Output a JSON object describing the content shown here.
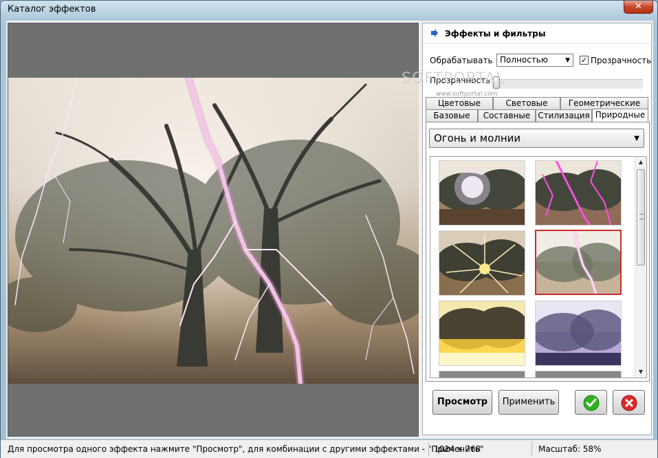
{
  "window": {
    "title": "Каталог эффектов",
    "close_glyph": "✕"
  },
  "panel": {
    "header_title": "Эффекты и фильтры",
    "header_icon": "blue-arrow-right-icon",
    "process_label": "Обрабатывать",
    "process_value": "Полностью",
    "transparency_checkbox_label": "Прозрачность",
    "transparency_checked": true,
    "transparency_slider_label": "Прозрачность",
    "transparency_level": 0,
    "watermark": "SOFTPORTAL",
    "watermark_sub": "www.softportal.com"
  },
  "tabs": {
    "row_top": [
      "Цветовые",
      "Световые",
      "Геометрические"
    ],
    "row_bottom": [
      "Базовые",
      "Составные",
      "Стилизация",
      "Природные"
    ],
    "active": "Природные"
  },
  "category": {
    "selected": "Огонь и молнии"
  },
  "effects": [
    {
      "name": "sun-flare"
    },
    {
      "name": "purple-lightning"
    },
    {
      "name": "sunburst-rays"
    },
    {
      "name": "white-lightning",
      "selected": true
    },
    {
      "name": "fire-glow"
    },
    {
      "name": "violet-haze"
    }
  ],
  "buttons": {
    "preview": "Просмотр",
    "apply": "Применить",
    "ok_icon": "green-check-icon",
    "cancel_icon": "red-x-icon"
  },
  "status": {
    "hint": "Для просмотра одного эффекта нажмите \"Просмотр\", для комбинации с другими эффектами - \"Применить\"",
    "resolution": "1024 x 768",
    "zoom": "Масштаб: 58%"
  }
}
